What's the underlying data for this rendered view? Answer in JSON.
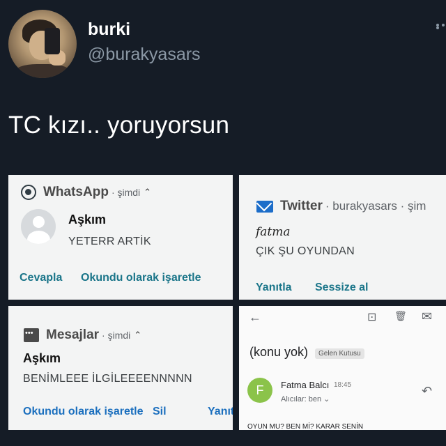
{
  "tweet": {
    "display_name": "burki",
    "handle": "@burakyasars",
    "text": "TC kızı.. yoruyorsun"
  },
  "whatsapp": {
    "app": "WhatsApp",
    "time": "· şimdi",
    "sender": "Aşkım",
    "message": "YETERR ARTİK",
    "actions": [
      "Cevapla",
      "Okundu olarak işaretle"
    ]
  },
  "twitter": {
    "app": "Twitter",
    "meta": "· burakyasars · şim",
    "signature": "fatma",
    "message": "ÇIK ŞU OYUNDAN",
    "actions": [
      "Yanıtla",
      "Sessize al"
    ]
  },
  "sms": {
    "app": "Mesajlar",
    "time": "· şimdi",
    "sender": "Aşkım",
    "message": "BENİMLEEE İLGİLEEEENNNNN",
    "actions": [
      "Okundu olarak işaretle",
      "Sil",
      "Yanıt"
    ]
  },
  "email": {
    "subject": "(konu yok)",
    "label": "Gelen Kutusu",
    "avatar_letter": "F",
    "from": "Fatma Balcı",
    "time": "18:45",
    "to": "Alıcılar: ben ⌄",
    "body": "OYUN MU? BEN Mİ? KARAR SENİN"
  },
  "icons": {
    "back": "←",
    "archive": "⊡",
    "delete": "🗑",
    "mail": "✉",
    "reply": "↶",
    "chevron": "^"
  },
  "colors": {
    "background": "#151c26",
    "action_teal": "#1a7589",
    "action_blue": "#1b6fbe"
  }
}
